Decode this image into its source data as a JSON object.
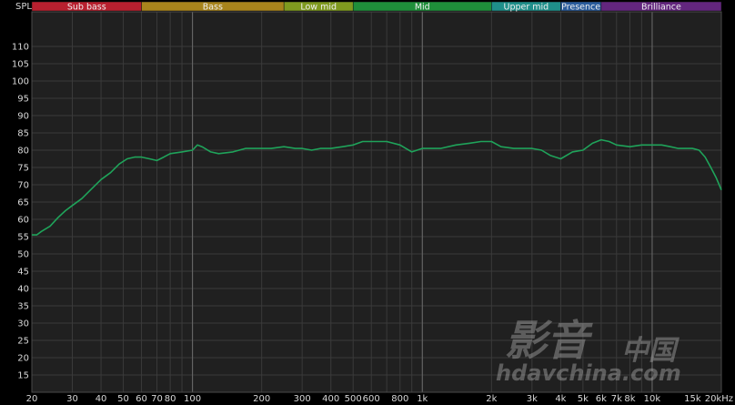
{
  "chart_data": {
    "type": "line",
    "ylabel": "SPL",
    "x_scale": "log",
    "xlim": [
      20,
      20000
    ],
    "ylim": [
      10,
      120
    ],
    "y_ticks": [
      15,
      20,
      25,
      30,
      35,
      40,
      45,
      50,
      55,
      60,
      65,
      70,
      75,
      80,
      85,
      90,
      95,
      100,
      105,
      110
    ],
    "x_ticks": [
      {
        "value": 20,
        "label": "20"
      },
      {
        "value": 30,
        "label": "30"
      },
      {
        "value": 40,
        "label": "40"
      },
      {
        "value": 50,
        "label": "50"
      },
      {
        "value": 60,
        "label": "60"
      },
      {
        "value": 70,
        "label": "70"
      },
      {
        "value": 80,
        "label": "80"
      },
      {
        "value": 100,
        "label": "100"
      },
      {
        "value": 200,
        "label": "200"
      },
      {
        "value": 300,
        "label": "300"
      },
      {
        "value": 400,
        "label": "400"
      },
      {
        "value": 500,
        "label": "500"
      },
      {
        "value": 600,
        "label": "600"
      },
      {
        "value": 800,
        "label": "800"
      },
      {
        "value": 1000,
        "label": "1k"
      },
      {
        "value": 2000,
        "label": "2k"
      },
      {
        "value": 3000,
        "label": "3k"
      },
      {
        "value": 4000,
        "label": "4k"
      },
      {
        "value": 5000,
        "label": "5k"
      },
      {
        "value": 6000,
        "label": "6k"
      },
      {
        "value": 7000,
        "label": "7k"
      },
      {
        "value": 8000,
        "label": "8k"
      },
      {
        "value": 10000,
        "label": "10k"
      },
      {
        "value": 15000,
        "label": "15k"
      },
      {
        "value": 20000,
        "label": "20kHz"
      }
    ],
    "major_vlines": [
      100,
      1000,
      10000
    ],
    "grid": true,
    "bands": [
      {
        "name": "Sub bass",
        "from": 20,
        "to": 60,
        "color": "#b8202f"
      },
      {
        "name": "Bass",
        "from": 60,
        "to": 250,
        "color": "#a8841c"
      },
      {
        "name": "Low mid",
        "from": 250,
        "to": 500,
        "color": "#7f9a1f"
      },
      {
        "name": "Mid",
        "from": 500,
        "to": 2000,
        "color": "#1f8f3a"
      },
      {
        "name": "Upper mid",
        "from": 2000,
        "to": 4000,
        "color": "#1f8f8a"
      },
      {
        "name": "Presence",
        "from": 4000,
        "to": 6000,
        "color": "#2a5c9c"
      },
      {
        "name": "Brilliance",
        "from": 6000,
        "to": 20000,
        "color": "#63267e"
      }
    ],
    "series": [
      {
        "color": "#1fa35a",
        "x": [
          20,
          21,
          22,
          24,
          26,
          28,
          30,
          33,
          36,
          40,
          44,
          48,
          52,
          56,
          60,
          65,
          70,
          75,
          80,
          90,
          100,
          105,
          110,
          120,
          130,
          150,
          170,
          200,
          220,
          250,
          280,
          300,
          330,
          360,
          400,
          450,
          500,
          550,
          600,
          700,
          800,
          900,
          1000,
          1100,
          1200,
          1400,
          1600,
          1800,
          2000,
          2200,
          2500,
          2800,
          3000,
          3300,
          3600,
          4000,
          4500,
          5000,
          5500,
          6000,
          6500,
          7000,
          8000,
          9000,
          10000,
          11000,
          12000,
          13000,
          14000,
          15000,
          16000,
          17000,
          18000,
          19000,
          20000
        ],
        "y": [
          55.5,
          55.5,
          56.5,
          58,
          60.5,
          62.5,
          64,
          66,
          68.5,
          71.5,
          73.5,
          76,
          77.5,
          78,
          78,
          77.5,
          77,
          78,
          79,
          79.5,
          80,
          81.5,
          81,
          79.5,
          79,
          79.5,
          80.5,
          80.5,
          80.5,
          81,
          80.5,
          80.5,
          80,
          80.5,
          80.5,
          81,
          81.5,
          82.5,
          82.5,
          82.5,
          81.5,
          79.5,
          80.5,
          80.5,
          80.5,
          81.5,
          82,
          82.5,
          82.5,
          81,
          80.5,
          80.5,
          80.5,
          80,
          78.5,
          77.5,
          79.5,
          80,
          82,
          83,
          82.5,
          81.5,
          81,
          81.5,
          81.5,
          81.5,
          81,
          80.5,
          80.5,
          80.5,
          80,
          78,
          75,
          72,
          68.5
        ]
      }
    ]
  },
  "watermark": {
    "line1": "影音",
    "line2": "中国",
    "line3": "hdavchina.com"
  }
}
